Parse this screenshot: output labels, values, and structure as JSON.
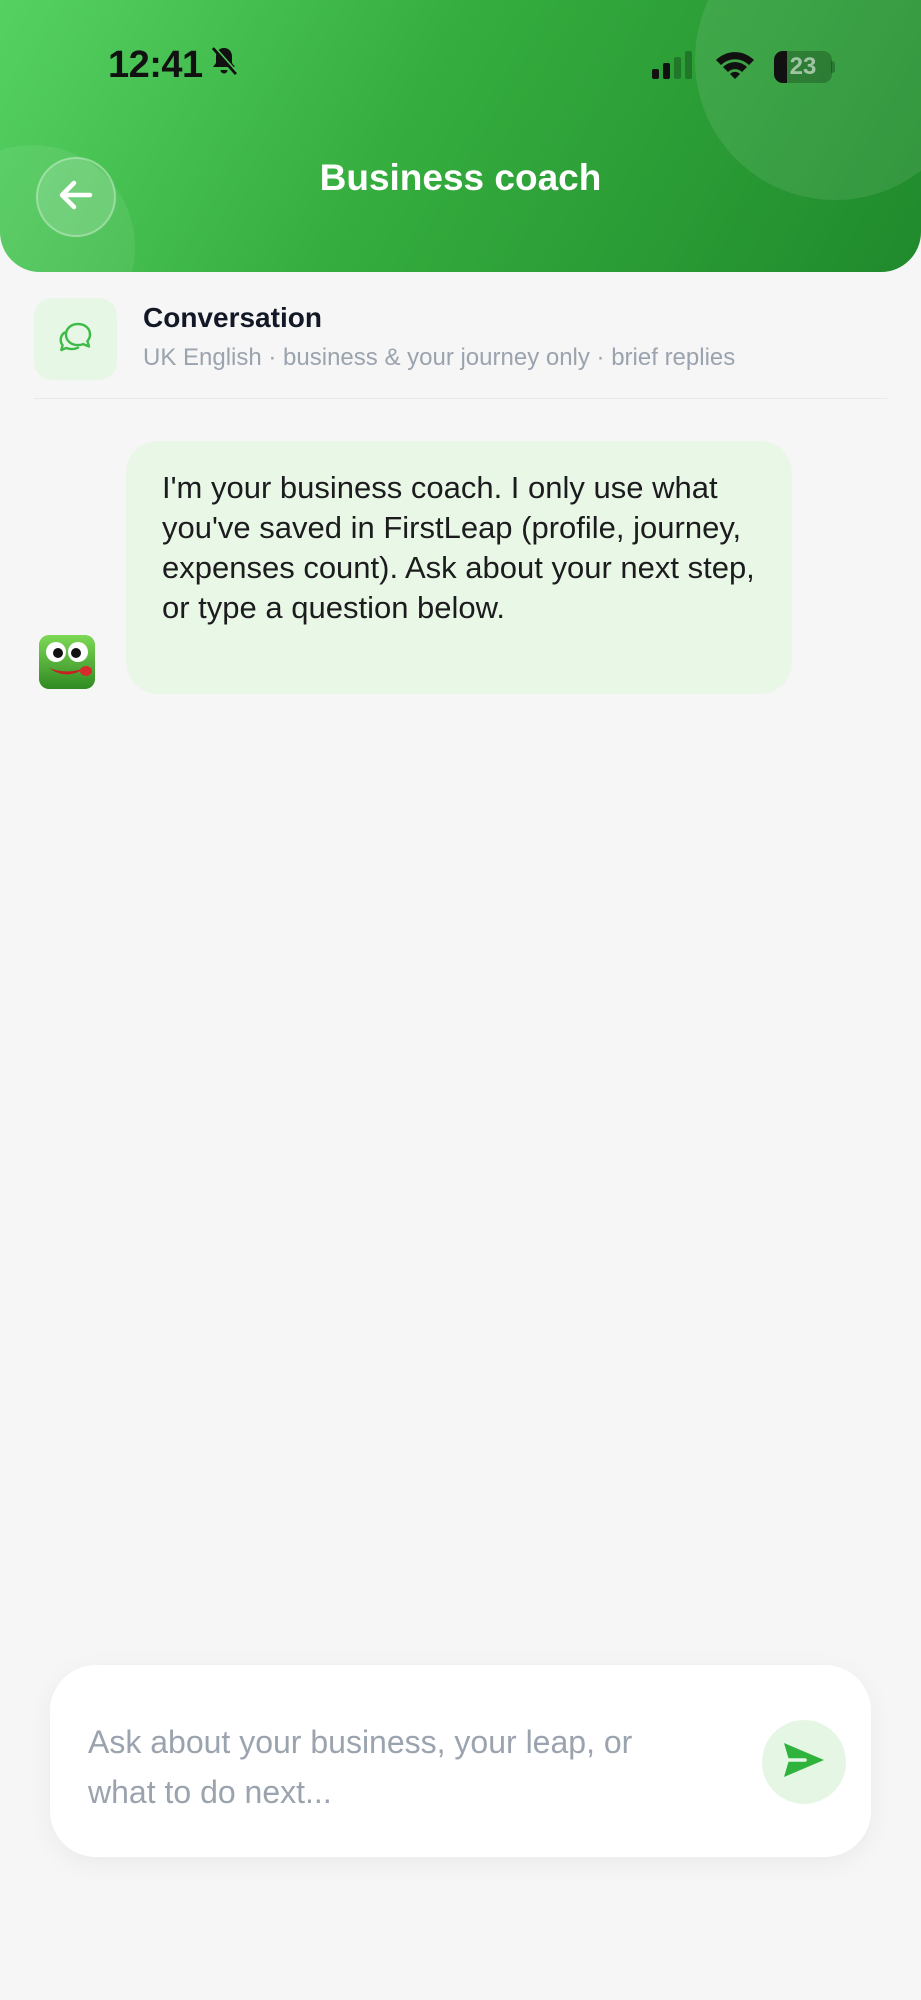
{
  "status_bar": {
    "time": "12:41",
    "battery_level": "23",
    "battery_fraction": 0.23
  },
  "header": {
    "title": "Business coach"
  },
  "conversation": {
    "title": "Conversation",
    "subtitle": "UK English · business & your journey only · brief replies"
  },
  "messages": [
    {
      "sender": "coach",
      "text": "I'm your business coach. I only use what you've saved in FirstLeap (profile, journey, expenses count). Ask about your next step, or type a question below."
    }
  ],
  "input": {
    "placeholder": "Ask about your business, your leap, or what to do next...",
    "value": ""
  },
  "colors": {
    "brand_green": "#35ad3e",
    "bubble_bg": "#e9f7e7",
    "muted_text": "#9aa3ae"
  },
  "icons": {
    "back": "arrow-left-icon",
    "conversation": "chat-bubbles-icon",
    "send": "send-icon",
    "avatar": "frog-avatar-icon"
  }
}
